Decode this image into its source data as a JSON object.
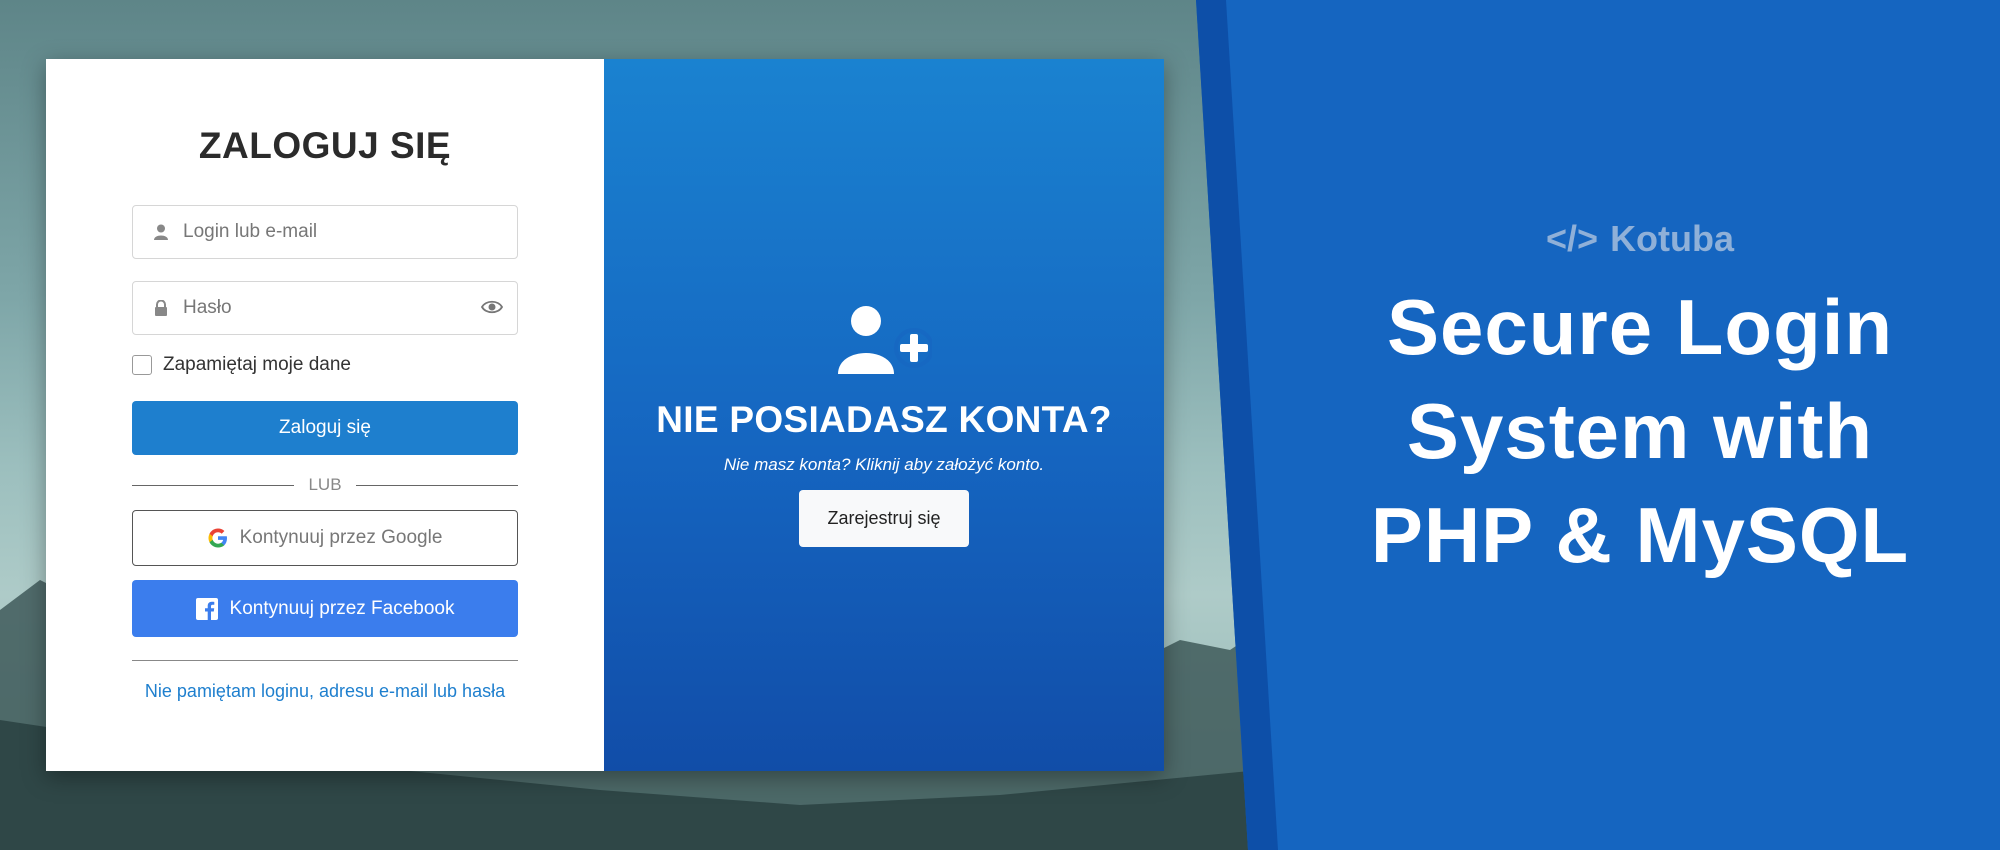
{
  "login": {
    "title": "ZALOGUJ SIĘ",
    "username_placeholder": "Login lub e-mail",
    "password_placeholder": "Hasło",
    "remember_label": "Zapamiętaj moje dane",
    "remember_checked": false,
    "submit_label": "Zaloguj się",
    "divider_text": "LUB",
    "google_label": "Kontynuuj przez Google",
    "facebook_label": "Kontynuuj przez Facebook",
    "forgot_link": "Nie pamiętam loginu, adresu e-mail lub hasła",
    "icons": [
      "user-icon",
      "lock-icon",
      "eye-icon",
      "google-icon",
      "facebook-icon"
    ]
  },
  "signup": {
    "title": "NIE POSIADASZ KONTA?",
    "subtitle": "Nie masz konta? Kliknij aby założyć konto.",
    "register_label": "Zarejestruj się",
    "icon": "add-user-icon"
  },
  "promo": {
    "brand_code": "</>",
    "brand_name": "Kotuba",
    "headline_line1": "Secure Login",
    "headline_line2": "System with",
    "headline_line3": "PHP & MySQL"
  },
  "colors": {
    "primary": "#1e7fce",
    "facebook": "#3b7ded",
    "panel_blue": "#1565c0",
    "brand_text": "#8fb0d8"
  }
}
